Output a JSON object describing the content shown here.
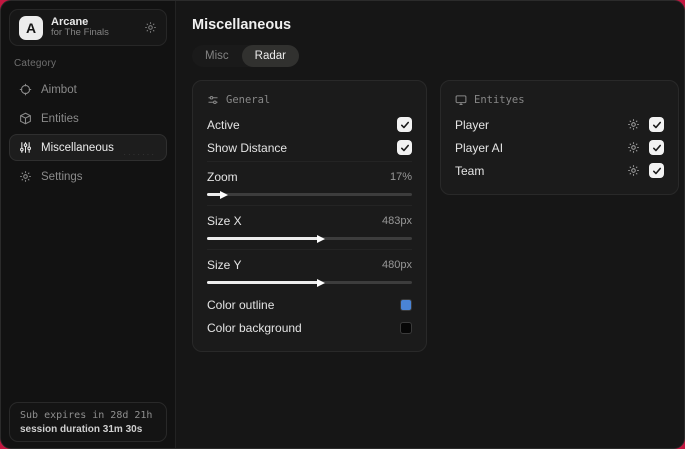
{
  "backdrop_color": "#c21740",
  "sidebar": {
    "brand": {
      "logo_letter": "A",
      "title": "Arcane",
      "subtitle": "for The Finals"
    },
    "category_label": "Category",
    "items": [
      {
        "label": "Aimbot"
      },
      {
        "label": "Entities"
      },
      {
        "label": "Miscellaneous"
      },
      {
        "label": "Settings"
      }
    ],
    "footer": {
      "expiry": "Sub expires in 28d 21h",
      "session": "session duration 31m 30s"
    }
  },
  "main": {
    "title": "Miscellaneous",
    "tabs": [
      {
        "label": "Misc"
      },
      {
        "label": "Radar"
      }
    ],
    "active_tab": "Radar",
    "general": {
      "title": "General",
      "toggles": [
        {
          "label": "Active",
          "checked": true
        },
        {
          "label": "Show Distance",
          "checked": true
        }
      ],
      "sliders": [
        {
          "label": "Zoom",
          "value": "17%",
          "position_pct": 8
        },
        {
          "label": "Size X",
          "value": "483px",
          "position_pct": 55
        },
        {
          "label": "Size Y",
          "value": "480px",
          "position_pct": 55
        }
      ],
      "colors": [
        {
          "label": "Color outline",
          "color": "#4a84d6"
        },
        {
          "label": "Color background",
          "color": "#060606"
        }
      ]
    },
    "entities": {
      "title": "Entityes",
      "rows": [
        {
          "label": "Player",
          "checked": true
        },
        {
          "label": "Player AI",
          "checked": true
        },
        {
          "label": "Team",
          "checked": true
        }
      ]
    }
  }
}
